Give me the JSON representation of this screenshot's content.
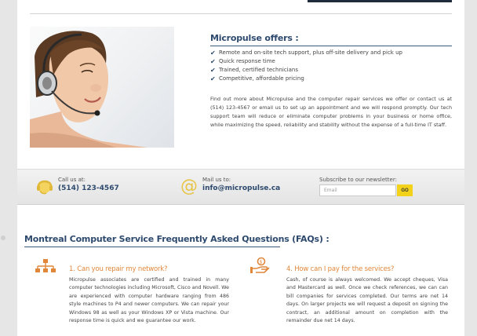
{
  "offers": {
    "title": "Micropulse offers :",
    "items": [
      "Remote and on-site tech support, plus off-site delivery and pick up",
      "Quick response time",
      "Trained, certified technicians",
      "Competitive, affordable pricing"
    ],
    "paragraph": "Find out more about Micropulse and the computer repair services we offer or contact us at (514) 123-4567 or email us to set up an appointment and we will respond promptly. Our tech support team will reduce or eliminate computer problems in your business or home office, while maximizing the speed, reliability and stability without the expense of a full-time IT staff."
  },
  "contact": {
    "call_label": "Call us at:",
    "phone": "(514) 123-4567",
    "mail_label": "Mail us to:",
    "email": "info@micropulse.ca",
    "newsletter_label": "Subscribe to our newsletter:",
    "email_placeholder": "Email",
    "go_label": "GO"
  },
  "faq": {
    "title": "Montreal Computer Service Frequently Asked Questions (FAQs) :",
    "items": [
      {
        "question": "1. Can you repair my network?",
        "answer": "Micropulse associates are certified and trained in many computer technologies including Microsoft, Cisco and Novell. We are experienced with computer hardware ranging from 486 style machines to P4 and newer computers. We can repair your Windows 98 as well as your Windows XP or Vista machine. Our response time is quick and we guarantee our work."
      },
      {
        "question": "4. How can I pay for the services?",
        "answer": "Cash, of course is always welcomed. We accept cheques, Visa and Mastercard as well. Once we check references, we can can bill companies for services completed. Our terms are net 14 days. On larger projects we will request a deposit on signing the contract, an additional amount on completion with the remainder due net 14 days."
      }
    ]
  },
  "colors": {
    "accent_blue": "#2d4a6e",
    "faq_orange": "#e0873a",
    "go_yellow": "#f2d21b",
    "icon_gold": "#e8c445"
  },
  "icons": {
    "phone": "headset-contact-icon",
    "mail": "at-sign-icon",
    "faq1": "network-icon",
    "faq2": "payment-icon"
  }
}
